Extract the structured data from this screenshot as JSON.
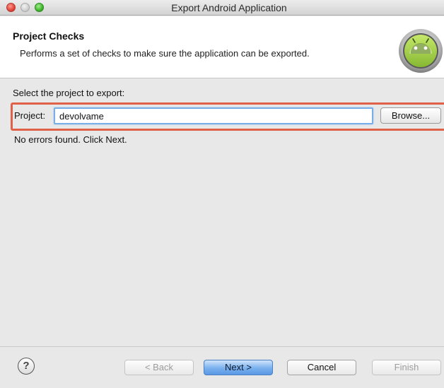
{
  "window": {
    "title": "Export Android Application"
  },
  "header": {
    "title": "Project Checks",
    "description": "Performs a set of checks to make sure the application can be exported.",
    "logo_icon": "android-logo-icon"
  },
  "form": {
    "section_label": "Select the project to export:",
    "project_label": "Project:",
    "project_value": "devolvame",
    "browse_label": "Browse...",
    "highlight_color": "#e06048"
  },
  "status": {
    "message": "No errors found. Click Next."
  },
  "footer": {
    "help_icon": "help-icon",
    "help_glyph": "?",
    "back_label": "< Back",
    "next_label": "Next >",
    "cancel_label": "Cancel",
    "finish_label": "Finish"
  }
}
